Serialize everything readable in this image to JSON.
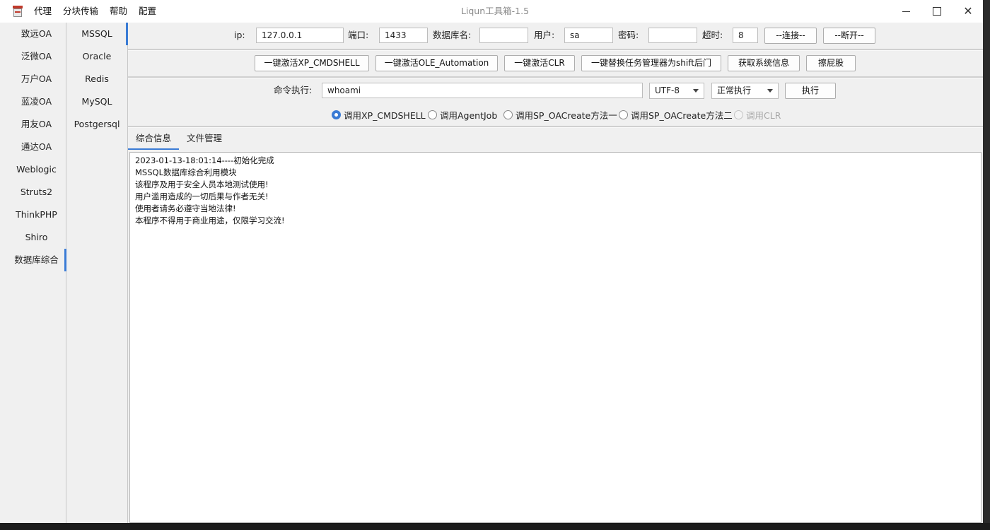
{
  "window": {
    "title": "Liqun工具箱-1.5",
    "menu": [
      "代理",
      "分块传输",
      "帮助",
      "配置"
    ]
  },
  "sidebar_primary": {
    "items": [
      "致远OA",
      "泛微OA",
      "万户OA",
      "蓝凌OA",
      "用友OA",
      "通达OA",
      "Weblogic",
      "Struts2",
      "ThinkPHP",
      "Shiro",
      "数据库综合"
    ],
    "selected": "数据库综合"
  },
  "sidebar_secondary": {
    "items": [
      "MSSQL",
      "Oracle",
      "Redis",
      "MySQL",
      "Postgersql"
    ],
    "selected": "MSSQL"
  },
  "connection": {
    "ip_label": "ip:",
    "ip_value": "127.0.0.1",
    "port_label": "端口:",
    "port_value": "1433",
    "dbname_label": "数据库名:",
    "dbname_value": "",
    "user_label": "用户:",
    "user_value": "sa",
    "password_label": "密码:",
    "password_value": "",
    "timeout_label": "超时:",
    "timeout_value": "8",
    "connect_button": "--连接--",
    "disconnect_button": "--断开--"
  },
  "actions": {
    "xp_cmdshell": "一键激活XP_CMDSHELL",
    "ole_automation": "一键激活OLE_Automation",
    "clr": "一键激活CLR",
    "shift_backdoor": "一键替换任务管理器为shift后门",
    "sysinfo": "获取系统信息",
    "clean": "擦屁股"
  },
  "command": {
    "label": "命令执行:",
    "value": "whoami",
    "encoding": "UTF-8",
    "mode": "正常执行",
    "execute_button": "执行"
  },
  "methods": {
    "options": [
      "调用XP_CMDSHELL",
      "调用AgentJob",
      "调用SP_OACreate方法一",
      "调用SP_OACreate方法二",
      "调用CLR"
    ],
    "selected": "调用XP_CMDSHELL",
    "disabled": [
      "调用CLR"
    ]
  },
  "tabs": [
    "综合信息",
    "文件管理"
  ],
  "active_tab": "综合信息",
  "log_lines": [
    "2023-01-13-18:01:14----初始化完成",
    "MSSQL数据库综合利用模块",
    "该程序及用于安全人员本地测试使用!",
    "用户滥用造成的一切后果与作者无关!",
    "使用者请务必遵守当地法律!",
    "本程序不得用于商业用途，仅限学习交流!"
  ],
  "colors": {
    "accent": "#3a7bd5",
    "window_bg": "#f0f0f0"
  }
}
